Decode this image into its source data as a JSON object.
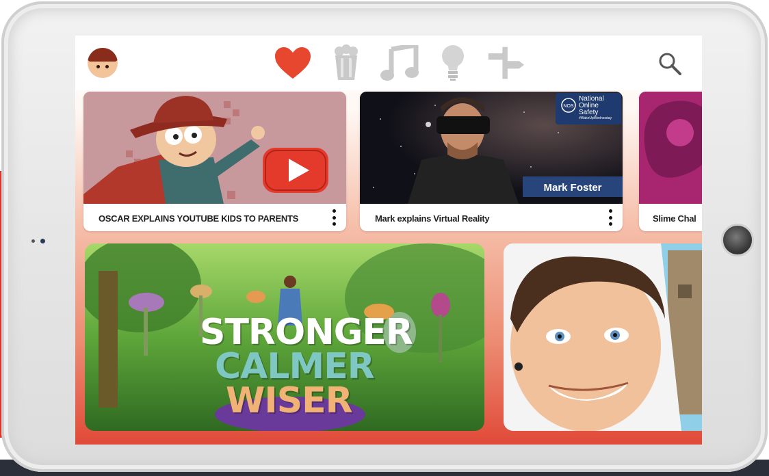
{
  "colors": {
    "brand_red": "#e8472f",
    "inactive_icon": "#c9c9c9",
    "accent_red": "#d8362c"
  },
  "topbar": {
    "categories": [
      {
        "icon": "heart-icon",
        "state": "selected"
      },
      {
        "icon": "popcorn-icon",
        "state": "inactive"
      },
      {
        "icon": "music-note-icon",
        "state": "inactive"
      },
      {
        "icon": "lightbulb-icon",
        "state": "inactive"
      },
      {
        "icon": "signpost-icon",
        "state": "inactive"
      }
    ],
    "search_icon": "search-icon"
  },
  "videos": [
    {
      "title": "OSCAR EXPLAINS YOUTUBE KIDS TO PARENTS"
    },
    {
      "title": "Mark explains Virtual Reality",
      "badge_title": "National Online Safety",
      "badge_abbr": "NOS",
      "badge_tag": "#WakeUpWednesday",
      "name_banner": "Mark Foster"
    },
    {
      "title": "Slime Chal"
    }
  ],
  "featured": {
    "lines": [
      "STRONGER",
      "CALMER",
      "WISER"
    ]
  }
}
